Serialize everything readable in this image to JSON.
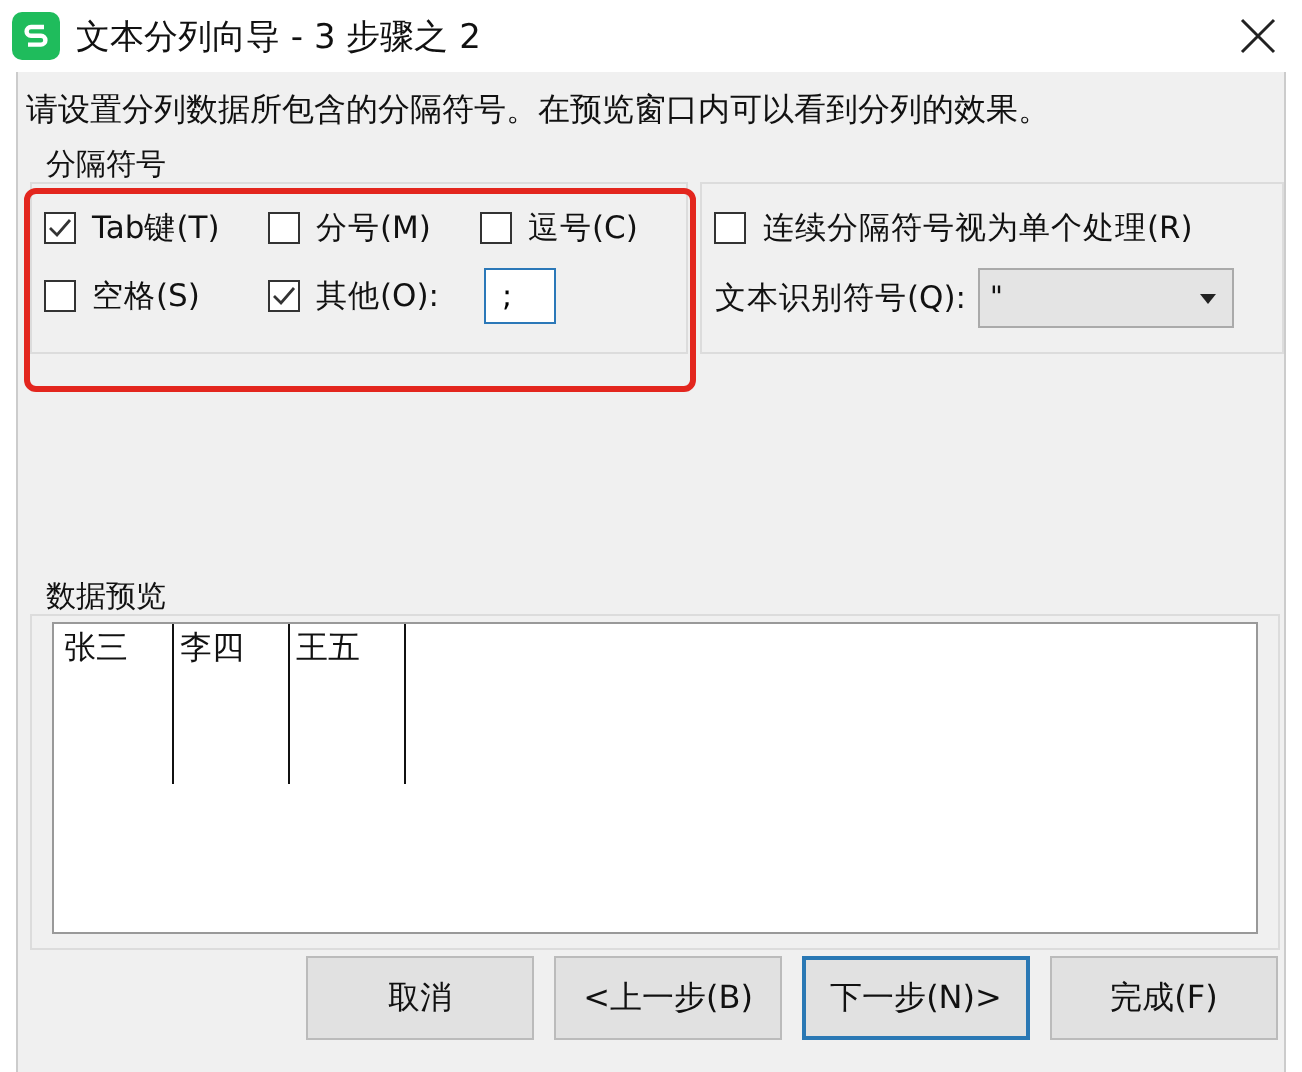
{
  "window": {
    "title": "文本分列向导 - 3 步骤之 2"
  },
  "instruction": "请设置分列数据所包含的分隔符号。在预览窗口内可以看到分列的效果。",
  "delimiters": {
    "legend": "分隔符号",
    "other_value": ";",
    "options": [
      {
        "label": "Tab键(T)",
        "checked": true
      },
      {
        "label": "分号(M)",
        "checked": false
      },
      {
        "label": "逗号(C)",
        "checked": false
      },
      {
        "label": "空格(S)",
        "checked": false
      },
      {
        "label": "其他(O):",
        "checked": true
      }
    ]
  },
  "treat_consecutive": {
    "label": "连续分隔符号视为单个处理(R)",
    "checked": false
  },
  "text_qualifier": {
    "label": "文本识别符号(Q):",
    "value": "\""
  },
  "preview": {
    "legend": "数据预览",
    "columns": [
      "张三",
      "李四",
      "王五"
    ]
  },
  "buttons": [
    {
      "label": "取消",
      "focused": false
    },
    {
      "label": "<上一步(B)",
      "focused": false
    },
    {
      "label": "下一步(N)>",
      "focused": true
    },
    {
      "label": "完成(F)",
      "focused": false
    }
  ]
}
